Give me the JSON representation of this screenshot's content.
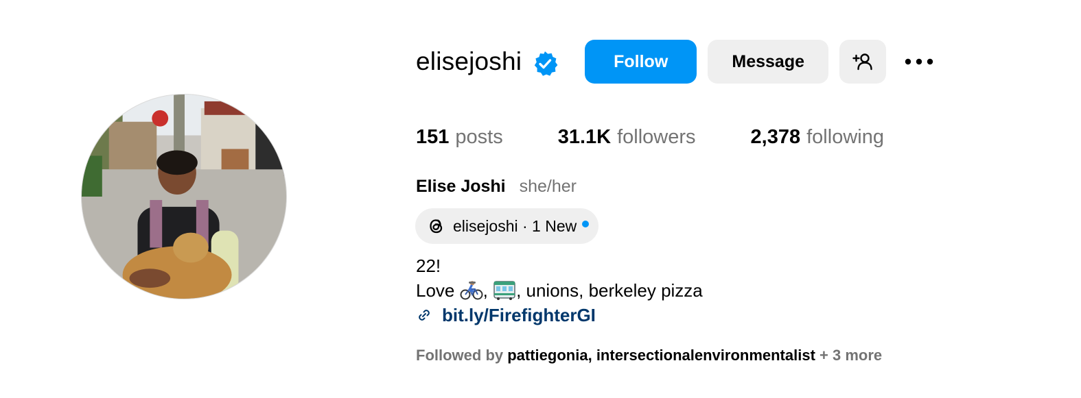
{
  "profile": {
    "username": "elisejoshi",
    "verified": true,
    "full_name": "Elise Joshi",
    "pronouns": "she/her"
  },
  "actions": {
    "follow_label": "Follow",
    "message_label": "Message",
    "suggest_icon": "person-add-icon",
    "more_icon": "more-horizontal-icon"
  },
  "stats": [
    {
      "value": "151",
      "label": "posts"
    },
    {
      "value": "31.1K",
      "label": "followers"
    },
    {
      "value": "2,378",
      "label": "following"
    }
  ],
  "threads": {
    "text": "elisejoshi · 1 New",
    "icon": "threads-icon",
    "has_new": true
  },
  "bio": {
    "line1": "22!",
    "line2_prefix": "Love ",
    "emoji_1": "person-biking-emoji",
    "separator": ", ",
    "emoji_2": "tram-emoji",
    "line2_suffix": ", unions, berkeley pizza",
    "link_icon": "link-icon",
    "link": "bit.ly/FirefighterGI"
  },
  "followed_by": {
    "prefix": "Followed by ",
    "accounts": [
      "pattiegonia",
      "intersectionalenvironmentalist"
    ],
    "separator": ", ",
    "more": " + 3 more"
  },
  "colors": {
    "accent": "#0095f6",
    "button_grey": "#efefef",
    "secondary_text": "#737373",
    "link": "#00376b"
  }
}
